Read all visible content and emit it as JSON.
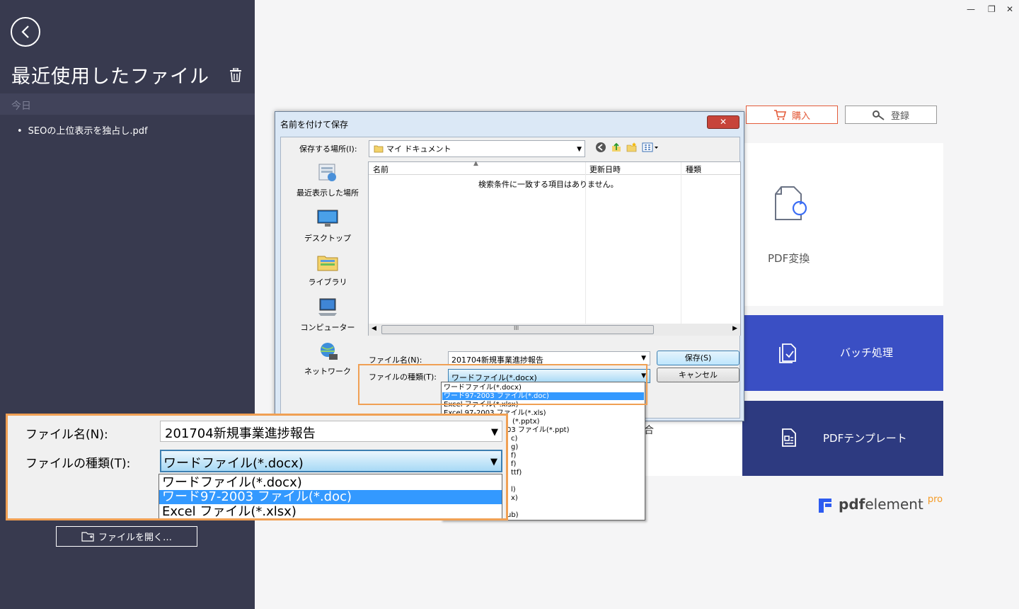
{
  "sidebar": {
    "title": "最近使用したファイル",
    "section_today": "今日",
    "recent_files": [
      "SEOの上位表示を独占し.pdf"
    ],
    "open_file_label": "ファイルを開く…"
  },
  "header": {
    "buy_label": "購入",
    "login_label": "登録"
  },
  "cards": {
    "partial_label": "合",
    "convert_label": "PDF変換",
    "batch_label": "バッチ処理",
    "template_label": "PDFテンプレート"
  },
  "logo": {
    "bold": "pdf",
    "rest": "element",
    "suffix": "pro"
  },
  "dialog": {
    "title": "名前を付けて保存",
    "close_label": "✕",
    "location_label": "保存する場所(I):",
    "location_value": "マイ ドキュメント",
    "places": [
      "最近表示した場所",
      "デスクトップ",
      "ライブラリ",
      "コンピューター",
      "ネットワーク"
    ],
    "columns": [
      "名前",
      "更新日時",
      "種類"
    ],
    "empty_message": "検索条件に一致する項目はありません。",
    "scroll_grip": "III",
    "filename_label": "ファイル名(N):",
    "filename_value": "201704新規事業進捗報告",
    "filetype_label": "ファイルの種類(T):",
    "filetype_value": "ワードファイル(*.docx)",
    "save_label": "保存(S)",
    "cancel_label": "キャンセル",
    "filetype_options": [
      "ワードファイル(*.docx)",
      "ワード97-2003 ファイル(*.doc)",
      "Excel ファイル(*.xlsx)",
      "Excel 97-2003 ファイル(*.xls)",
      "(*.pptx)",
      "03 ファイル(*.ppt)",
      "c)",
      "g)",
      "f)",
      "f)",
      "ttf)",
      "l)",
      "x)",
      "ub)"
    ]
  },
  "zoom": {
    "filename_label": "ファイル名(N):",
    "filename_value": "201704新規事業進捗報告",
    "filetype_label": "ファイルの種類(T):",
    "filetype_value": "ワードファイル(*.docx)",
    "options": [
      "ワードファイル(*.docx)",
      "ワード97-2003 ファイル(*.doc)",
      "Excel ファイル(*.xlsx)"
    ]
  },
  "colors": {
    "sidebar": "#383a4f",
    "batch": "#3a4fc4",
    "template": "#2d3a80",
    "highlight": "#f0a054",
    "buy": "#e35b3a"
  }
}
